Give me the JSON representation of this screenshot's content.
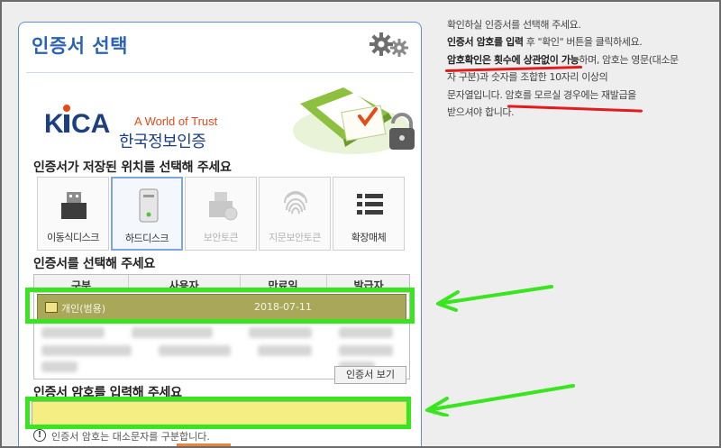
{
  "dialog": {
    "title": "인증서 선택",
    "gear_icon": "gear-icon"
  },
  "banner": {
    "logo_text": "KICA",
    "tagline": "A World of Trust",
    "org_name": "한국정보인증"
  },
  "storage": {
    "heading": "인증서가 저장된 위치를 선택해 주세요",
    "items": [
      {
        "label": "이동식디스크",
        "icon": "usb-drive-icon",
        "state": "enabled"
      },
      {
        "label": "하드디스크",
        "icon": "hard-disk-icon",
        "state": "selected"
      },
      {
        "label": "보안토큰",
        "icon": "security-token-icon",
        "state": "disabled"
      },
      {
        "label": "지문보안토큰",
        "icon": "fingerprint-icon",
        "state": "disabled"
      },
      {
        "label": "확장매체",
        "icon": "list-icon",
        "state": "enabled"
      }
    ]
  },
  "cert_list": {
    "heading": "인증서를 선택해 주세요",
    "columns": [
      "구분",
      "사용자",
      "만료일",
      "발급자"
    ],
    "rows": [
      {
        "type": "개인(범용)",
        "user": "",
        "expiry": "2018-07-11",
        "issuer": ""
      }
    ],
    "view_button": "인증서 보기"
  },
  "password": {
    "heading": "인증서 암호를 입력해 주세요",
    "value": "",
    "hint": "인증서 암호는 대소문자를 구분합니다."
  },
  "instructions": {
    "line1": "확인하실 인증서를 선택해 주세요.",
    "line2_bold": "인증서 암호를 입력",
    "line2_rest": " 후 \"확인\" 버튼을 클릭하세요.",
    "line3_bold": "암호확인은 횟수에 상관없이 가능",
    "line3_rest": "하며, 암호는 영문(대소문",
    "line4": "자 구분)과 숫자를 조합한 10자리 이상의",
    "line5_a": "문자열입니다. ",
    "line5_b": "암호를 모르실 경우에는 재발급을",
    "line6": "받으셔야 합니다."
  },
  "colors": {
    "title_blue": "#2a62b8",
    "highlight_green": "#39e51e",
    "underline_red": "#e21b1b",
    "selected_row": "#a9a85a",
    "password_field": "#f5ee82"
  }
}
